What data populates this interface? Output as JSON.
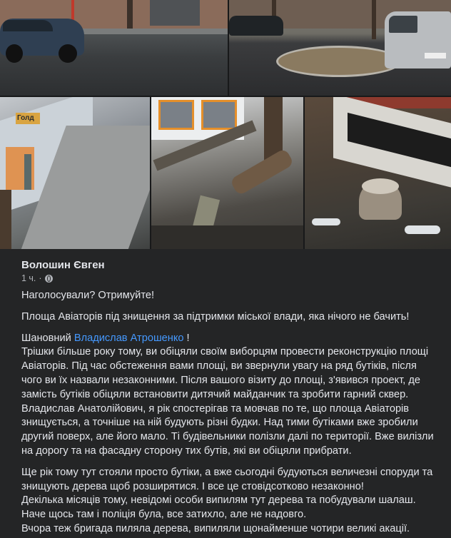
{
  "colors": {
    "background": "#242526",
    "text": "#e4e6eb",
    "secondary": "#b0b3b8",
    "link": "#4599ff"
  },
  "gallery": {
    "photo_1_alt": "parked car on asphalt",
    "photo_2_alt": "minivan near paved square",
    "photo_3_alt": "sidewalk with cut trees",
    "photo_4_alt": "cut tree logs",
    "photo_5_alt": "tree stump near building",
    "sign_text": "Голд"
  },
  "post": {
    "author": "Волошин Євген",
    "time": "1 ч.",
    "separator": "·",
    "privacy_icon": "globe-icon",
    "paragraphs": {
      "p1": "Наголосували? Отримуйте!",
      "p2": "Площа Авіаторів під знищення за підтримки міської влади, яка нічого не бачить!",
      "p3_prefix": "Шановний ",
      "p3_link": "Владислав Атрошенко",
      "p3_suffix": " !",
      "p3_body": "Трішки більше року тому, ви обіцяли своїм виборцям провести реконструкцію площі Авіаторів. Під час обстеження вами площі, ви звернули увагу на ряд бутіків, після чого ви їх назвали незаконними. Після вашого візиту до площі, з'явився проект, де замість бутіків обіцяли встановити дитячий майданчик та зробити гарний сквер.",
      "p3_body2": "Владислав Анатолійович, я рік спостерігав та мовчав по те, що площа Авіаторів знищується, а точніше на ній будують різні будки. Над тими бутіками вже зробили другий поверх, але його мало. Ті будівельники полізли далі по території. Вже вилізли на дорогу та на фасадну сторону тих бутів, які ви обіцяли прибрати.",
      "p4_line1": "Ще рік тому тут стояли просто бутіки, а вже сьогодні будуються величезні споруди та знищують дерева щоб розширятися. І все це стовідсотково незаконно!",
      "p4_line2": "Декілька місяців тому, невідомі особи випилям тут дерева та побудували шалаш. Наче щось там і поліція була, все затихло, але не надовго.",
      "p4_line3": "Вчора теж бригада пиляла дерева, випиляли щонайменше чотири великі акації."
    }
  }
}
